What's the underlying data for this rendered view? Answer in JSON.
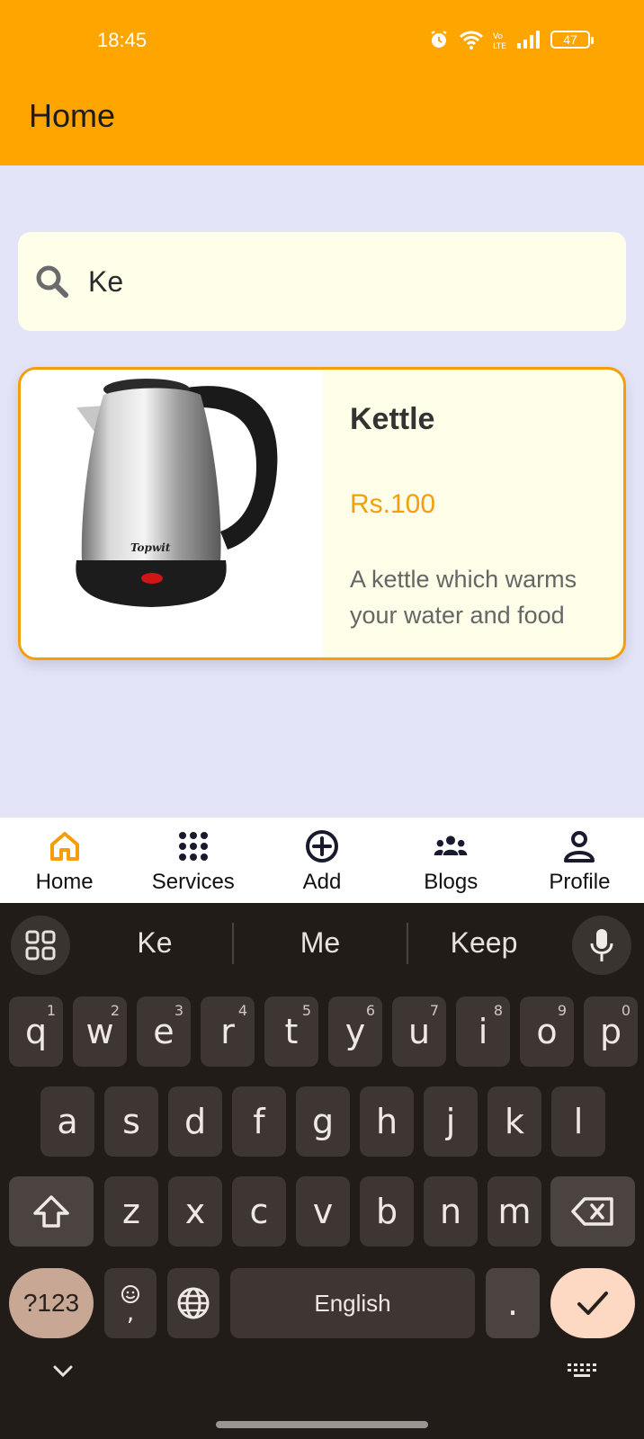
{
  "status_bar": {
    "time": "18:45",
    "battery": "47"
  },
  "header": {
    "title": "Home"
  },
  "search": {
    "value": "Ke",
    "icon": "search-icon"
  },
  "product": {
    "name": "Kettle",
    "price": "Rs.100",
    "description": "A kettle which warms your water and food",
    "image_brand": "Topwit"
  },
  "bottom_nav": {
    "items": [
      {
        "label": "Home",
        "icon": "home-icon",
        "active": true
      },
      {
        "label": "Services",
        "icon": "grid-dots-icon"
      },
      {
        "label": "Add",
        "icon": "plus-circle-icon"
      },
      {
        "label": "Blogs",
        "icon": "group-icon"
      },
      {
        "label": "Profile",
        "icon": "person-icon"
      }
    ]
  },
  "keyboard": {
    "suggestions": [
      "Ke",
      "Me",
      "Keep"
    ],
    "row1": [
      {
        "k": "q",
        "h": "1"
      },
      {
        "k": "w",
        "h": "2"
      },
      {
        "k": "e",
        "h": "3"
      },
      {
        "k": "r",
        "h": "4"
      },
      {
        "k": "t",
        "h": "5"
      },
      {
        "k": "y",
        "h": "6"
      },
      {
        "k": "u",
        "h": "7"
      },
      {
        "k": "i",
        "h": "8"
      },
      {
        "k": "o",
        "h": "9"
      },
      {
        "k": "p",
        "h": "0"
      }
    ],
    "row2": [
      "a",
      "s",
      "d",
      "f",
      "g",
      "h",
      "j",
      "k",
      "l"
    ],
    "row3": [
      "z",
      "x",
      "c",
      "v",
      "b",
      "n",
      "m"
    ],
    "symbols_label": "?123",
    "comma_label": ",",
    "space_label": "English",
    "period_label": "."
  },
  "colors": {
    "accent": "#ffa500",
    "card_border": "#f59e0b",
    "price": "#f59e0b",
    "background": "#e3e4f8"
  }
}
